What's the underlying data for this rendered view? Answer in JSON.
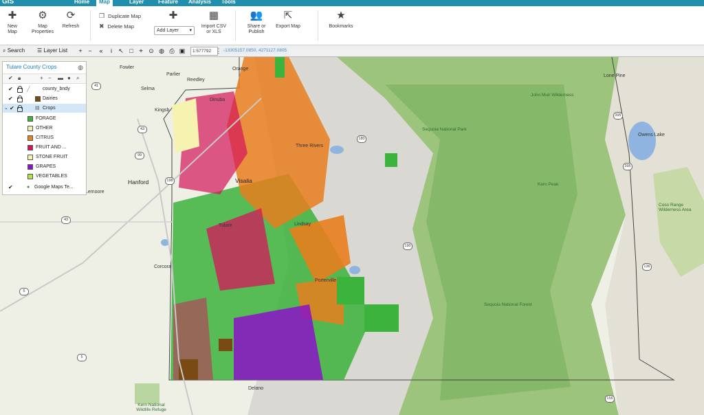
{
  "app": {
    "logo": "GIS"
  },
  "nav_tabs": [
    {
      "label": "Home",
      "active": false
    },
    {
      "label": "Map",
      "active": true
    },
    {
      "label": "Layer",
      "active": false
    },
    {
      "label": "Feature",
      "active": false
    },
    {
      "label": "Analysis",
      "active": false
    },
    {
      "label": "Tools",
      "active": false
    }
  ],
  "ribbon": {
    "new_map": "New Map",
    "map_properties": "Map Properties",
    "refresh": "Refresh",
    "duplicate_map": "Duplicate Map",
    "delete_map": "Delete Map",
    "add_layer": "Add Layer",
    "import_csv": "Import CSV or XLS",
    "share_publish": "Share or Publish",
    "export_map": "Export Map",
    "bookmarks": "Bookmarks"
  },
  "toolbar": {
    "search": "Search",
    "layer_list": "Layer List",
    "scale": "1:577792",
    "coords": "-13305157.0850, 4271127.0805"
  },
  "layer_panel": {
    "title": "Tulare County Crops",
    "layers": [
      {
        "label": "county_bndy",
        "checked": true,
        "locked": true
      },
      {
        "label": "Dairies",
        "checked": true,
        "locked": true
      },
      {
        "label": "Crops",
        "checked": true,
        "locked": true,
        "selected": true
      }
    ],
    "legend": [
      {
        "label": "FORAGE",
        "color": "#3cb33c"
      },
      {
        "label": "OTHER",
        "color": "#f3f0a8"
      },
      {
        "label": "CITRUS",
        "color": "#e87e1e"
      },
      {
        "label": "FRUIT AND ...",
        "color": "#d4145a"
      },
      {
        "label": "STONE FRUIT",
        "color": "#f6f2b0"
      },
      {
        "label": "GRAPES",
        "color": "#8a12c8"
      },
      {
        "label": "VEGETABLES",
        "color": "#b4e04a"
      }
    ],
    "basemap": {
      "label": "Google Maps Te...",
      "checked": true
    }
  },
  "map_labels": {
    "fowler": "Fowler",
    "parlier": "Parlier",
    "orange": "Orange",
    "reedley": "Reedley",
    "selma": "Selma",
    "kingsburg": "Kingsb",
    "dinuba": "Dinuba",
    "hanford": "Hanford",
    "lemoore": "Lemoore",
    "visalia": "Visalia",
    "tulare": "Tulare",
    "lindsay": "Lindsay",
    "porterville": "Porterville",
    "corcoran": "Corcora",
    "delano": "Delano",
    "kern_refuge": "Kern National Wildlife Refuge",
    "sequoia_np": "Sequoia National Park",
    "sequoia_nf": "Sequoia National Forest",
    "lone_pine": "Lone Pine",
    "owens_lake": "Owens Lake",
    "coso_range": "Coso Range Wilderness Area",
    "three_rivers": "Three Rivers",
    "kern_peak": "Kern Peak",
    "john_muir": "John Muir Wilderness"
  },
  "route_shields": [
    "41",
    "43",
    "99",
    "198",
    "180",
    "190",
    "395",
    "5",
    "65",
    "178",
    "155",
    "136"
  ],
  "colors": {
    "accent": "#1f8fad",
    "forage": "#3cb33c",
    "citrus": "#e87e1e",
    "fruit": "#d4145a",
    "grapes": "#8a12c8",
    "dairy": "#7a4a14",
    "mountain": "#8fbf6a",
    "water": "#8fb4e0"
  }
}
